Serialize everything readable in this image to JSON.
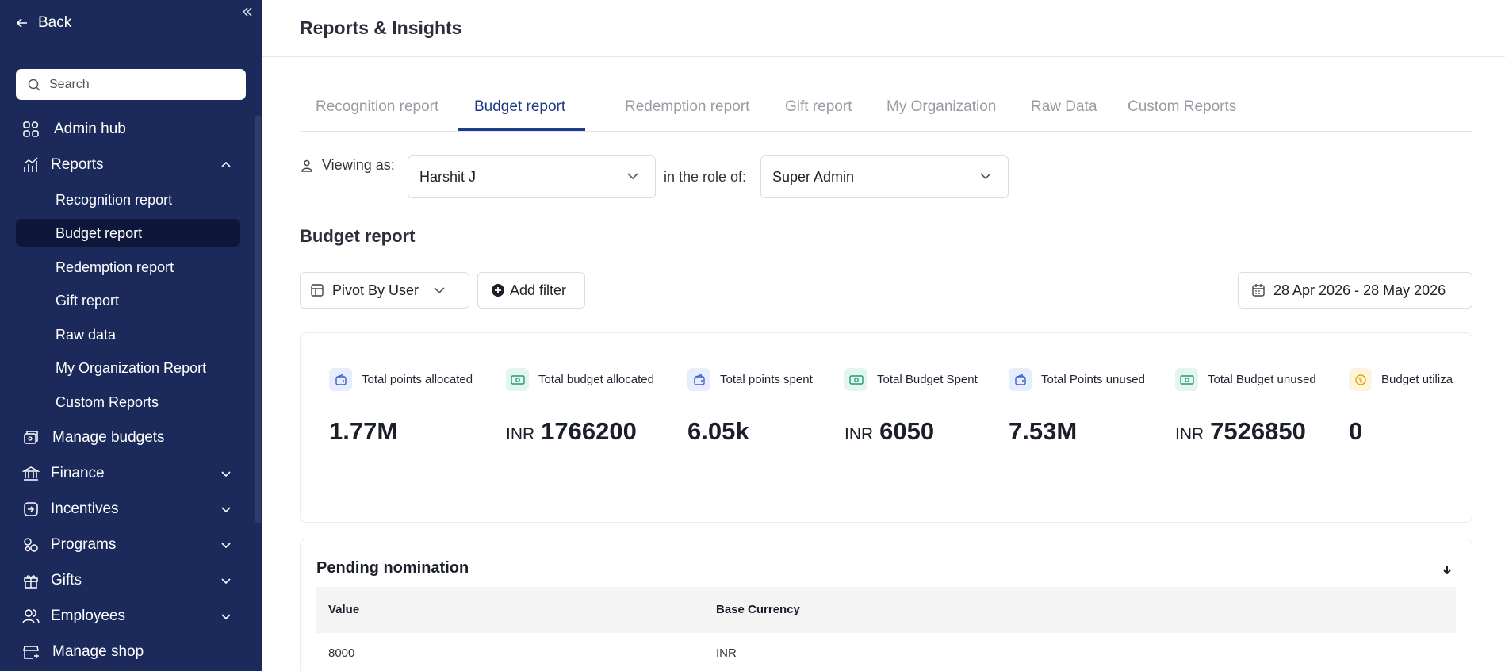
{
  "sidebar": {
    "back_label": "Back",
    "search_placeholder": "Search",
    "items": [
      {
        "label": "Admin hub",
        "icon": "grid-icon"
      },
      {
        "label": "Reports",
        "icon": "chart-icon",
        "expanded": true
      },
      {
        "label": "Manage budgets",
        "icon": "budget-icon"
      },
      {
        "label": "Finance",
        "icon": "bank-icon"
      },
      {
        "label": "Incentives",
        "icon": "incentive-icon"
      },
      {
        "label": "Programs",
        "icon": "programs-icon"
      },
      {
        "label": "Gifts",
        "icon": "gift-icon"
      },
      {
        "label": "Employees",
        "icon": "users-icon"
      },
      {
        "label": "Manage shop",
        "icon": "shop-icon"
      }
    ],
    "reports_subitems": [
      "Recognition report",
      "Budget report",
      "Redemption report",
      "Gift report",
      "Raw data",
      "My Organization Report",
      "Custom Reports"
    ],
    "active_subitem": "Budget report"
  },
  "main": {
    "page_title": "Reports & Insights",
    "tabs": [
      "Recognition report",
      "Budget report",
      "Redemption report",
      "Gift report",
      "My Organization",
      "Raw Data",
      "Custom Reports"
    ],
    "active_tab": "Budget report",
    "viewing_as_label": "Viewing as:",
    "viewing_as_value": "Harshit J",
    "role_label": "in the role of:",
    "role_value": "Super Admin",
    "section_title": "Budget report",
    "pivot_label": "Pivot By User",
    "add_filter_label": "Add filter",
    "date_range": "28 Apr 2026 - 28 May 2026",
    "stats": [
      {
        "label": "Total points allocated",
        "value": "1.77M",
        "currency": "",
        "icon": "wallet-icon",
        "color": "blue"
      },
      {
        "label": "Total budget allocated",
        "value": "1766200",
        "currency": "INR",
        "icon": "cash-icon",
        "color": "green"
      },
      {
        "label": "Total points spent",
        "value": "6.05k",
        "currency": "",
        "icon": "wallet-icon",
        "color": "blue"
      },
      {
        "label": "Total Budget Spent",
        "value": "6050",
        "currency": "INR",
        "icon": "cash-icon",
        "color": "green"
      },
      {
        "label": "Total Points unused",
        "value": "7.53M",
        "currency": "",
        "icon": "wallet-icon",
        "color": "blue"
      },
      {
        "label": "Total Budget unused",
        "value": "7526850",
        "currency": "INR",
        "icon": "cash-icon",
        "color": "green"
      },
      {
        "label": "Budget utiliza",
        "value": "0",
        "currency": "",
        "icon": "coin-icon",
        "color": "yellow"
      }
    ],
    "pending": {
      "title": "Pending nomination",
      "columns": [
        "Value",
        "Base Currency"
      ],
      "rows": [
        [
          "8000",
          "INR"
        ]
      ]
    }
  },
  "colors": {
    "sidebar_bg": "#1b2a5a",
    "sidebar_active": "#0d173a",
    "accent": "#1e3a8a"
  }
}
